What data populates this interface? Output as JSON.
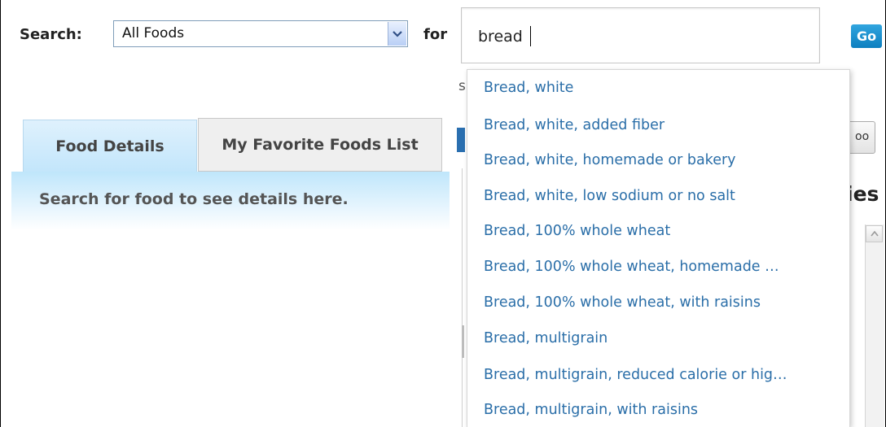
{
  "search": {
    "label": "Search:",
    "category_selected": "All Foods",
    "for_label": "for",
    "query": "bread",
    "go_label": "Go"
  },
  "tabs": [
    {
      "label": "Food Details"
    },
    {
      "label": "My Favorite Foods List"
    }
  ],
  "details": {
    "message": "Search for food to see details here."
  },
  "background": {
    "partial_s": "s",
    "partial_button": "oo",
    "partial_heading": "ies"
  },
  "suggestions": [
    "Bread, white",
    "Bread, white, added fiber",
    "Bread, white, homemade or bakery",
    "Bread, white, low sodium or no salt",
    "Bread, 100% whole wheat",
    "Bread, 100% whole wheat, homemade …",
    "Bread, 100% whole wheat, with raisins",
    "Bread, multigrain",
    "Bread, multigrain, reduced calorie or hig…",
    "Bread, multigrain, with raisins"
  ],
  "colors": {
    "link": "#2a6ea8",
    "tab_active": "#c3e6fb",
    "go_button": "#1891d0"
  }
}
